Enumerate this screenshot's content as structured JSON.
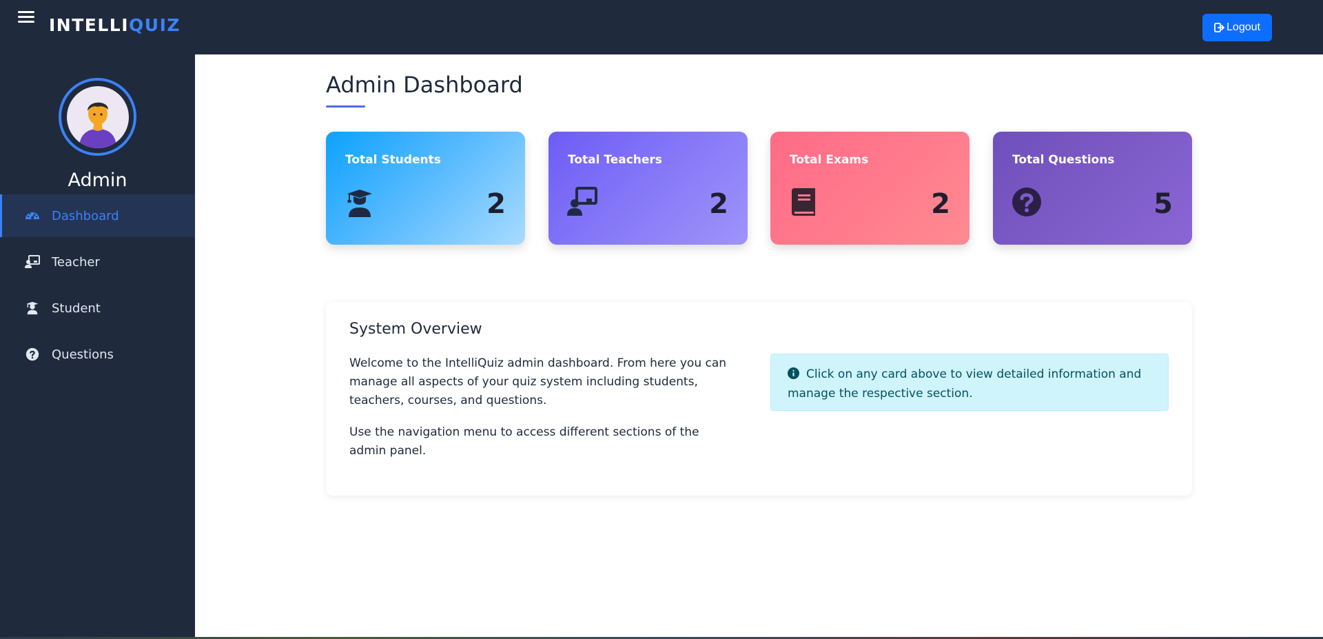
{
  "header": {
    "brand_part1": "INTELLI",
    "brand_part2": "QUIZ",
    "logout_label": "Logout"
  },
  "sidebar": {
    "user_name": "Admin",
    "items": [
      {
        "label": "Dashboard",
        "icon": "dashboard-icon",
        "active": true
      },
      {
        "label": "Teacher",
        "icon": "teacher-icon",
        "active": false
      },
      {
        "label": "Student",
        "icon": "student-icon",
        "active": false
      },
      {
        "label": "Questions",
        "icon": "question-icon",
        "active": false
      }
    ]
  },
  "main": {
    "title": "Admin Dashboard",
    "cards": [
      {
        "label": "Total Students",
        "value": "2",
        "icon": "graduation-icon"
      },
      {
        "label": "Total Teachers",
        "value": "2",
        "icon": "teacher-board-icon"
      },
      {
        "label": "Total Exams",
        "value": "2",
        "icon": "book-icon"
      },
      {
        "label": "Total Questions",
        "value": "5",
        "icon": "question-circle-icon"
      }
    ],
    "overview": {
      "title": "System Overview",
      "paragraph1": "Welcome to the IntelliQuiz admin dashboard. From here you can manage all aspects of your quiz system including students, teachers, courses, and questions.",
      "paragraph2": "Use the navigation menu to access different sections of the admin panel.",
      "info": "Click on any card above to view detailed information and manage the respective section."
    }
  },
  "colors": {
    "sidebar_bg": "#1f2a3d",
    "accent": "#3b82f6",
    "logout_bg": "#0d6efd",
    "info_bg": "#cff4fc",
    "info_text": "#055160"
  }
}
